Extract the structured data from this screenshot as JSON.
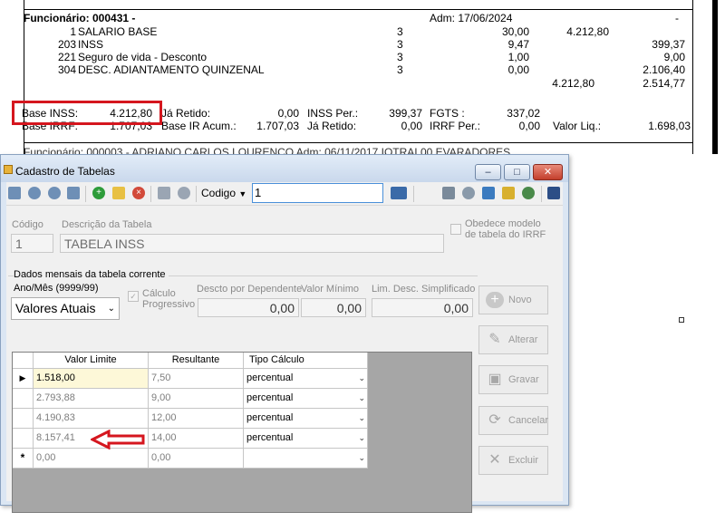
{
  "report": {
    "employee_line": "Funcionário: 000431 -",
    "admission": "Adm: 17/06/2024",
    "dash": "-",
    "items": [
      {
        "code": "1",
        "desc": "SALARIO BASE",
        "ref": "3",
        "qty": "30,00",
        "earn": "4.212,80",
        "deduct": ""
      },
      {
        "code": "203",
        "desc": "INSS",
        "ref": "3",
        "qty": "9,47",
        "earn": "",
        "deduct": "399,37"
      },
      {
        "code": "221",
        "desc": "Seguro de vida - Desconto",
        "ref": "3",
        "qty": "1,00",
        "earn": "",
        "deduct": "9,00"
      },
      {
        "code": "304",
        "desc": "DESC. ADIANTAMENTO QUINZENAL",
        "ref": "3",
        "qty": "0,00",
        "earn": "",
        "deduct": "2.106,40"
      }
    ],
    "total_earn": "4.212,80",
    "total_deduct": "2.514,77",
    "base_inss_label": "Base INSS:",
    "base_inss_value": "4.212,80",
    "ja_retido_label_1": "Já Retido:",
    "ja_retido_value_1": "0,00",
    "inss_per_label": "INSS Per.:",
    "inss_per_value": "399,37",
    "fgts_label": "FGTS :",
    "fgts_value": "337,02",
    "base_irrf_label": "Base IRRF:",
    "base_irrf_value": "1.707,03",
    "base_ir_acum_label": "Base IR Acum.:",
    "base_ir_acum_value": "1.707,03",
    "ja_retido_label_2": "Já Retido:",
    "ja_retido_value_2": "0,00",
    "irrf_per_label": "IRRF Per.:",
    "irrf_per_value": "0,00",
    "valor_liq_label": "Valor Liq.:",
    "valor_liq_value": "1.698,03",
    "next_line": "Funcionário: 000003 - ADRIANO CARLOS LOURENCO                                    Adm: 06/11/2017  IOTRAI 00   EVARADORES"
  },
  "window": {
    "title": "Cadastro de Tabelas",
    "toolbar": {
      "codigo_label": "Codigo",
      "search_value": "1"
    },
    "codigo_label": "Código",
    "codigo_value": "1",
    "descricao_label": "Descrição da Tabela",
    "descricao_value": "TABELA INSS",
    "obedece_label_1": "Obedece modelo",
    "obedece_label_2": "de tabela do IRRF",
    "dados_label": "Dados mensais da tabela corrente",
    "anomes_label": "Ano/Mês (9999/99)",
    "anomes_value": "Valores Atuais",
    "calculo_label_1": "Cálculo",
    "calculo_label_2": "Progressivo",
    "desconto_label": "Descto por Dependente",
    "desconto_value": "0,00",
    "valor_minimo_label": "Valor Mínimo",
    "valor_minimo_value": "0,00",
    "lim_desc_label": "Lim. Desc. Simplificado",
    "lim_desc_value": "0,00",
    "buttons": {
      "novo": "Novo",
      "alterar": "Alterar",
      "gravar": "Gravar",
      "cancelar": "Cancelar",
      "excluir": "Excluir"
    },
    "grid": {
      "headers": [
        "Valor Limite",
        "Resultante",
        "Tipo Cálculo"
      ],
      "rows": [
        {
          "indicator": "▶",
          "limite": "1.518,00",
          "resultante": "7,50",
          "tipo": "percentual"
        },
        {
          "indicator": "",
          "limite": "2.793,88",
          "resultante": "9,00",
          "tipo": "percentual"
        },
        {
          "indicator": "",
          "limite": "4.190,83",
          "resultante": "12,00",
          "tipo": "percentual"
        },
        {
          "indicator": "",
          "limite": "8.157,41",
          "resultante": "14,00",
          "tipo": "percentual"
        },
        {
          "indicator": "*",
          "limite": "0,00",
          "resultante": "0,00",
          "tipo": ""
        }
      ]
    }
  },
  "colors": {
    "highlight": "#d5161e",
    "selected_cell": "#fdf8d8"
  }
}
